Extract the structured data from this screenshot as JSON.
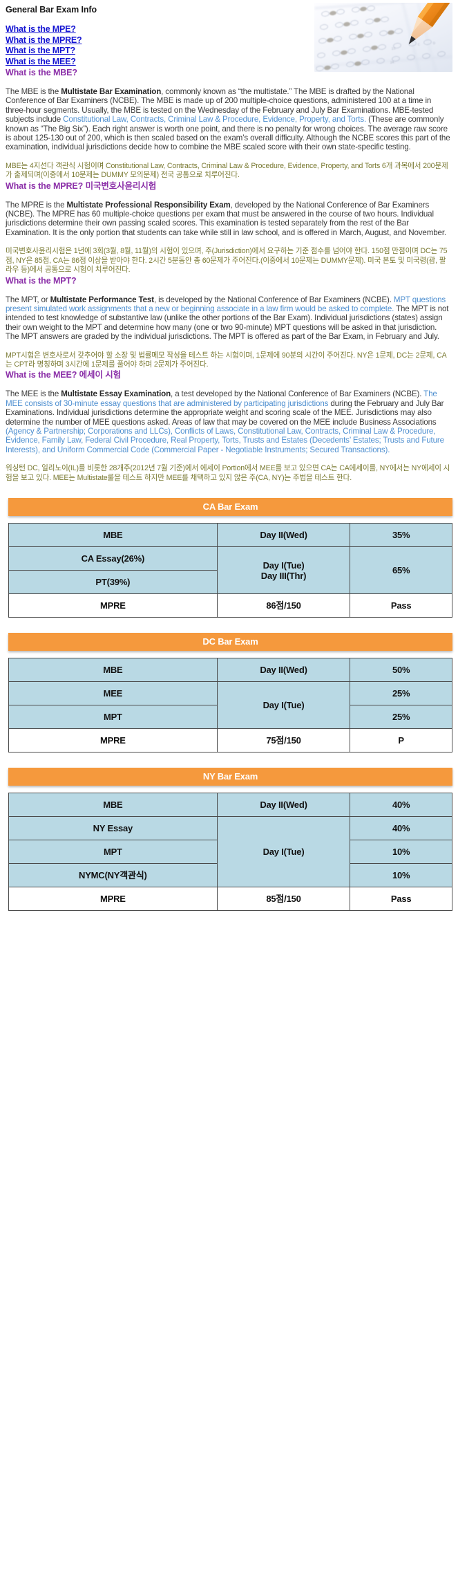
{
  "header": {
    "title": "General Bar Exam Info",
    "links": [
      "What is the MPE?",
      "What is the MPRE?",
      "What is the MPT?",
      "What is the MEE?"
    ],
    "hero_image_alt": "bubble-answer-sheet-with-pencil"
  },
  "sections": [
    {
      "id": "mbe",
      "heading": "What is the MBE?",
      "body_parts": [
        {
          "t": "The MBE is the ",
          "style": "plain"
        },
        {
          "t": "Multistate Bar Examination",
          "style": "bold"
        },
        {
          "t": ", commonly known as “the multistate.” The MBE is drafted by the National Conference of Bar Examiners (NCBE). The MBE is made up of 200 multiple-choice questions, administered 100 at a time in three-hour segments. Usually, the MBE is tested on the Wednesday of the February and July Bar Examinations. MBE-tested subjects include ",
          "style": "plain"
        },
        {
          "t": "Constitutional Law, Contracts, Criminal Law & Procedure, Evidence, Property, and Torts.",
          "style": "highlight"
        },
        {
          "t": " (These are commonly known as “The Big Six”). Each right answer is worth one point, and there is no penalty for wrong choices. The average raw score is about 125-130 out of 200, which is then scaled based on the exam’s overall difficulty. Although the NCBE scores this part of the examination, individual jurisdictions decide how to combine the MBE scaled score with their own state-specific testing.",
          "style": "plain"
        }
      ],
      "korean": "MBE는 4지선다 객관식 시험이며 Constitutional Law, Contracts, Criminal Law & Procedure, Evidence, Property, and Torts 6개 과목에서 200문제가 출제되며(이중에서 10문제는 DUMMY 모의문제) 전국 공통으로 치루어진다."
    },
    {
      "id": "mpre",
      "heading": "What is the MPRE? 미국변호사윤리시험",
      "body_parts": [
        {
          "t": "The MPRE is the ",
          "style": "plain"
        },
        {
          "t": "Multistate Professional Responsibility Exam",
          "style": "bold"
        },
        {
          "t": ", developed by the National Conference of Bar Examiners (NCBE). The MPRE has 60 multiple-choice questions per exam that must be answered in the course of two hours. Individual jurisdictions determine their own passing scaled scores. This examination is tested separately from the rest of the Bar Examination. It is the only portion that students can take while still in law school, and is offered in March, August, and November.",
          "style": "plain"
        }
      ],
      "korean": "미국변호사윤리시험은 1년에 3회(3월, 8월, 11월)의 시험이 있으며, 주(Jurisdiction)에서 요구하는 기준 점수를 넘어야 한다. 150점 만점이며 DC는 75점, NY은 85점, CA는 86점 이상을 받아야 한다. 2시간 5분동안 총 60문제가 주어진다.(이중에서 10문제는 DUMMY문제). 미국 본토 및 미국령(괌, 팔라우 등)에서 공통으로 시험이 치루어진다."
    },
    {
      "id": "mpt",
      "heading": "What is the MPT?",
      "body_parts": [
        {
          "t": "The MPT, or ",
          "style": "plain"
        },
        {
          "t": "Multistate Performance Test",
          "style": "bold"
        },
        {
          "t": ", is developed by the National Conference of Bar Examiners (NCBE). ",
          "style": "plain"
        },
        {
          "t": "MPT questions present simulated work assignments that a new or beginning associate in a law firm would be asked to complete.",
          "style": "highlight"
        },
        {
          "t": " The MPT is not intended to test knowledge of substantive law (unlike the other portions of the Bar Exam). Individual jurisdictions (states) assign their own weight to the MPT and determine how many (one or two 90-minute) MPT questions will be asked in that jurisdiction. The MPT answers are graded by the individual jurisdictions. The MPT is offered as part of the Bar Exam, in February and July.",
          "style": "plain"
        }
      ],
      "korean": "MPT시험은 변호사로서 갖추어야 할 소장 및 법률메모 작성을 테스트 하는 시험이며, 1문제에 90분의 시간이 주어진다. NY은 1문제, DC는 2문제, CA는 CPT라 명칭하며 3시간에 1문제를 풀어야 하며 2문제가 주어진다."
    },
    {
      "id": "mee",
      "heading": "What is the MEE? 에세이 시험",
      "body_parts": [
        {
          "t": "The MEE is the ",
          "style": "plain"
        },
        {
          "t": "Multistate Essay Examination",
          "style": "bold"
        },
        {
          "t": ", a test developed by the National Conference of Bar Examiners (NCBE). ",
          "style": "plain"
        },
        {
          "t": "The MEE consists of 30-minute essay questions that are administered by participating jurisdictions",
          "style": "highlight"
        },
        {
          "t": " during the February and July Bar Examinations. Individual jurisdictions determine the appropriate weight and scoring scale of the MEE. Jurisdictions may also determine the number of MEE questions asked. Areas of law that may be covered on the MEE include Business Associations ",
          "style": "plain"
        },
        {
          "t": "(Agency & Partnership; Corporations and LLCs), Conflicts of Laws, Constitutional Law, Contracts, Criminal Law & Procedure, Evidence, Family Law, Federal Civil Procedure, Real Property, Torts, Trusts and Estates (Decedents’ Estates; Trusts and Future Interests), and Uniform Commercial Code (Commercial Paper - Negotiable Instruments; Secured Transactions).",
          "style": "highlight"
        }
      ],
      "korean": "워싱턴 DC, 일리노이(IL)를 비롯한 28개주(2012년 7월 기준)에서 에세이 Portion에서 MEE를 보고 있으면 CA는 CA에세이를, NY에서는 NY에세이 시험을 보고 있다. MEE는 Multistate룰을 테스트 하지만 MEE를 채택하고 있지 않은 주(CA, NY)는 주법을 테스트 한다."
    }
  ],
  "tables": [
    {
      "id": "ca",
      "title": "CA Bar Exam",
      "rows": [
        {
          "subject": "MBE",
          "day": "Day II(Wed)",
          "day_rowspan": 1,
          "weight": "35%",
          "weight_rowspan": 1,
          "white": false
        },
        {
          "subject": "CA Essay(26%)",
          "day": "Day I(Tue)\nDay III(Thr)",
          "day_rowspan": 2,
          "weight": "65%",
          "weight_rowspan": 2,
          "white": false
        },
        {
          "subject": "PT(39%)",
          "day": null,
          "day_rowspan": 0,
          "weight": null,
          "weight_rowspan": 0,
          "white": false
        },
        {
          "subject": "MPRE",
          "day": "86점/150",
          "day_rowspan": 1,
          "weight": "Pass",
          "weight_rowspan": 1,
          "white": true
        }
      ]
    },
    {
      "id": "dc",
      "title": "DC Bar Exam",
      "rows": [
        {
          "subject": "MBE",
          "day": "Day II(Wed)",
          "day_rowspan": 1,
          "weight": "50%",
          "weight_rowspan": 1,
          "white": false
        },
        {
          "subject": "MEE",
          "day": "Day I(Tue)",
          "day_rowspan": 2,
          "weight": "25%",
          "weight_rowspan": 1,
          "white": false
        },
        {
          "subject": "MPT",
          "day": null,
          "day_rowspan": 0,
          "weight": "25%",
          "weight_rowspan": 1,
          "white": false
        },
        {
          "subject": "MPRE",
          "day": "75점/150",
          "day_rowspan": 1,
          "weight": "P",
          "weight_rowspan": 1,
          "white": true
        }
      ]
    },
    {
      "id": "ny",
      "title": "NY Bar Exam",
      "rows": [
        {
          "subject": "MBE",
          "day": "Day II(Wed)",
          "day_rowspan": 1,
          "weight": "40%",
          "weight_rowspan": 1,
          "white": false
        },
        {
          "subject": "NY Essay",
          "day": "Day I(Tue)",
          "day_rowspan": 3,
          "weight": "40%",
          "weight_rowspan": 1,
          "white": false
        },
        {
          "subject": "MPT",
          "day": null,
          "day_rowspan": 0,
          "weight": "10%",
          "weight_rowspan": 1,
          "white": false
        },
        {
          "subject": "NYMC(NY객관식)",
          "day": null,
          "day_rowspan": 0,
          "weight": "10%",
          "weight_rowspan": 1,
          "white": false
        },
        {
          "subject": "MPRE",
          "day": "85점/150",
          "day_rowspan": 1,
          "weight": "Pass",
          "weight_rowspan": 1,
          "white": true
        }
      ]
    }
  ],
  "colors": {
    "link": "#1414d2",
    "heading": "#8b2fa8",
    "highlight": "#4e8fd0",
    "korean": "#7a7a33",
    "table_header_bg": "#f5993d",
    "table_cell_bg": "#b9d9e4"
  }
}
